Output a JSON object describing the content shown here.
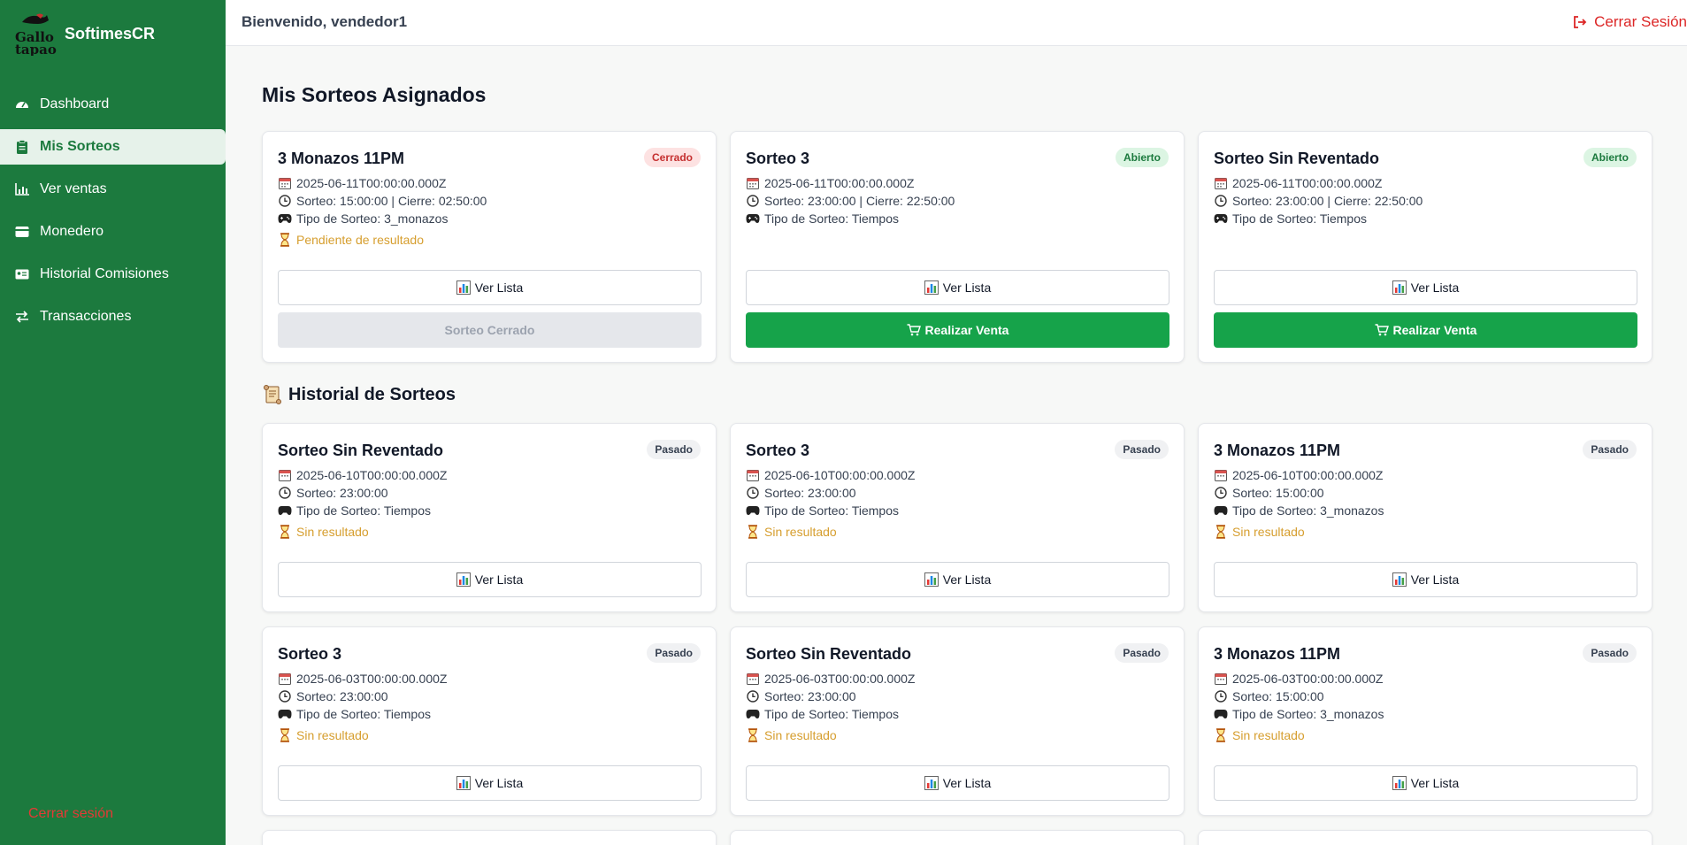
{
  "app": {
    "brand": "SoftimesCR",
    "logo_text": "Gallo tapao"
  },
  "sidebar": {
    "items": [
      {
        "label": "Dashboard",
        "icon": "gauge-icon"
      },
      {
        "label": "Mis Sorteos",
        "icon": "clipboard-icon",
        "active": true
      },
      {
        "label": "Ver ventas",
        "icon": "bar-chart-icon"
      },
      {
        "label": "Monedero",
        "icon": "wallet-icon"
      },
      {
        "label": "Historial Comisiones",
        "icon": "id-card-icon"
      },
      {
        "label": "Transacciones",
        "icon": "exchange-icon"
      }
    ],
    "logout_label": "Cerrar sesión"
  },
  "header": {
    "welcome": "Bienvenido, vendedor1",
    "logout_label": "Cerrar Sesión"
  },
  "assigned": {
    "title": "Mis Sorteos Asignados",
    "cards": [
      {
        "title": "3 Monazos 11PM",
        "status": "Cerrado",
        "date": "2025-06-11T00:00:00.000Z",
        "time": "Sorteo: 15:00:00 | Cierre: 02:50:00",
        "type": "Tipo de Sorteo: 3_monazos",
        "result": "Pendiente de resultado",
        "list_button": "Ver Lista",
        "action_button": "Sorteo Cerrado"
      },
      {
        "title": "Sorteo 3",
        "status": "Abierto",
        "date": "2025-06-11T00:00:00.000Z",
        "time": "Sorteo: 23:00:00 | Cierre: 22:50:00",
        "type": "Tipo de Sorteo: Tiempos",
        "list_button": "Ver Lista",
        "action_button": "Realizar Venta"
      },
      {
        "title": "Sorteo Sin Reventado",
        "status": "Abierto",
        "date": "2025-06-11T00:00:00.000Z",
        "time": "Sorteo: 23:00:00 | Cierre: 22:50:00",
        "type": "Tipo de Sorteo: Tiempos",
        "list_button": "Ver Lista",
        "action_button": "Realizar Venta"
      }
    ]
  },
  "history": {
    "title": "Historial de Sorteos",
    "cards": [
      {
        "title": "Sorteo Sin Reventado",
        "status": "Pasado",
        "date": "2025-06-10T00:00:00.000Z",
        "time": "Sorteo: 23:00:00",
        "type": "Tipo de Sorteo: Tiempos",
        "result": "Sin resultado",
        "list_button": "Ver Lista"
      },
      {
        "title": "Sorteo 3",
        "status": "Pasado",
        "date": "2025-06-10T00:00:00.000Z",
        "time": "Sorteo: 23:00:00",
        "type": "Tipo de Sorteo: Tiempos",
        "result": "Sin resultado",
        "list_button": "Ver Lista"
      },
      {
        "title": "3 Monazos 11PM",
        "status": "Pasado",
        "date": "2025-06-10T00:00:00.000Z",
        "time": "Sorteo: 15:00:00",
        "type": "Tipo de Sorteo: 3_monazos",
        "result": "Sin resultado",
        "list_button": "Ver Lista"
      },
      {
        "title": "Sorteo 3",
        "status": "Pasado",
        "date": "2025-06-03T00:00:00.000Z",
        "time": "Sorteo: 23:00:00",
        "type": "Tipo de Sorteo: Tiempos",
        "result": "Sin resultado",
        "list_button": "Ver Lista"
      },
      {
        "title": "Sorteo Sin Reventado",
        "status": "Pasado",
        "date": "2025-06-03T00:00:00.000Z",
        "time": "Sorteo: 23:00:00",
        "type": "Tipo de Sorteo: Tiempos",
        "result": "Sin resultado",
        "list_button": "Ver Lista"
      },
      {
        "title": "3 Monazos 11PM",
        "status": "Pasado",
        "date": "2025-06-03T00:00:00.000Z",
        "time": "Sorteo: 15:00:00",
        "type": "Tipo de Sorteo: 3_monazos",
        "result": "Sin resultado",
        "list_button": "Ver Lista"
      }
    ]
  },
  "colors": {
    "sidebar": "#1c7a3e",
    "primary_button": "#16a34a",
    "danger": "#dc2626",
    "pending": "#d69e2e"
  }
}
